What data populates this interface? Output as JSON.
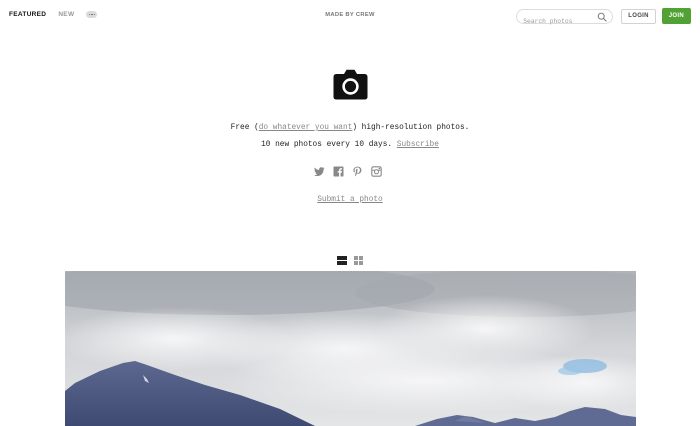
{
  "nav": {
    "featured": "FEATURED",
    "new": "NEW",
    "more_icon": "ellipsis-icon",
    "made_by": "MADE BY CREW",
    "search_placeholder": "Search photos",
    "login": "LOGIN",
    "join": "JOIN"
  },
  "hero": {
    "icon": "camera-icon",
    "tagline_before": "Free (",
    "tagline_link": "do whatever you want",
    "tagline_after": ") high-resolution photos.",
    "subline_text": "10 new photos every 10 days. ",
    "subline_link": "Subscribe",
    "social": [
      "twitter-icon",
      "facebook-icon",
      "pinterest-icon",
      "instagram-icon"
    ],
    "submit": "Submit a photo"
  },
  "view_toggle": {
    "options": [
      "list-view-icon",
      "grid-view-icon"
    ],
    "selected": "list-view-icon"
  },
  "colors": {
    "accent": "#51a135",
    "text": "#222222",
    "muted": "#888888"
  }
}
